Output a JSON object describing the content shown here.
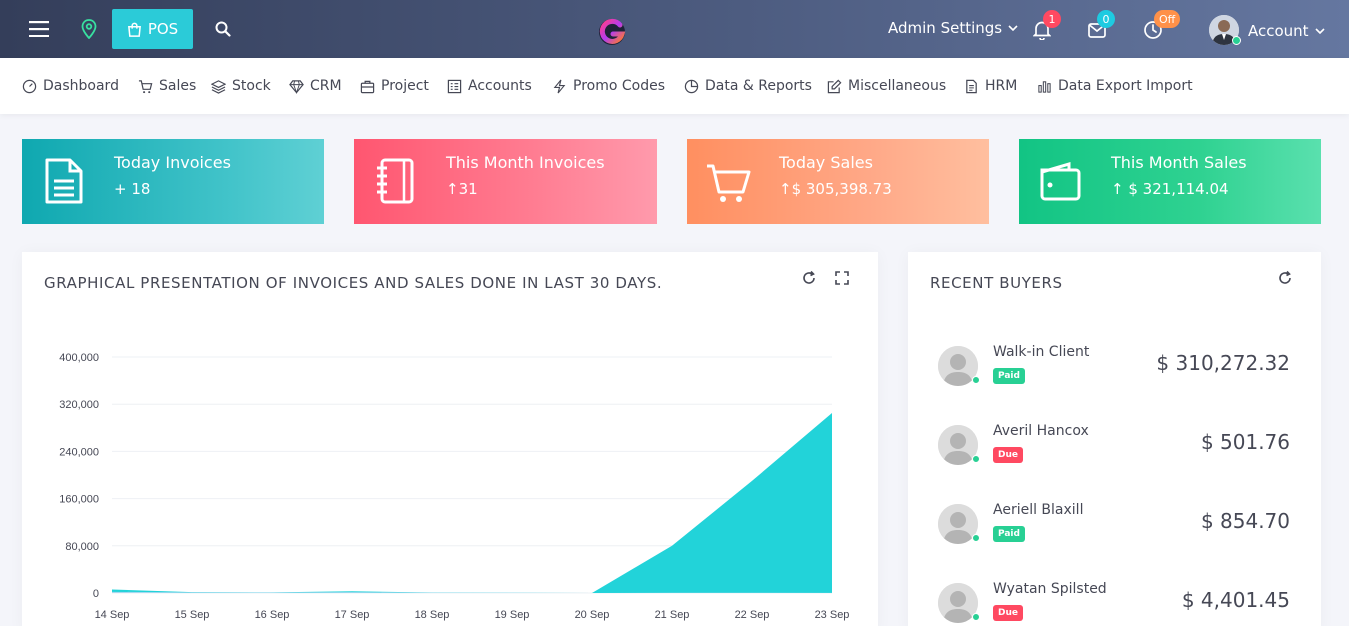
{
  "topbar": {
    "pos_label": "POS",
    "admin_settings": "Admin Settings",
    "notifications_count": "1",
    "messages_count": "0",
    "clock_status": "Off",
    "account_label": "Account"
  },
  "nav": {
    "items": [
      {
        "label": "Dashboard"
      },
      {
        "label": "Sales"
      },
      {
        "label": "Stock"
      },
      {
        "label": "CRM"
      },
      {
        "label": "Project"
      },
      {
        "label": "Accounts"
      },
      {
        "label": "Promo Codes"
      },
      {
        "label": "Data & Reports"
      },
      {
        "label": "Miscellaneous"
      },
      {
        "label": "HRM"
      },
      {
        "label": "Data Export Import"
      }
    ]
  },
  "stats": [
    {
      "title": "Today Invoices",
      "prefix": "+",
      "value": "18"
    },
    {
      "title": "This Month Invoices",
      "prefix": "↑",
      "value": "31"
    },
    {
      "title": "Today Sales",
      "prefix": "↑",
      "value": "$ 305,398.73"
    },
    {
      "title": "This Month Sales",
      "prefix": "↑",
      "value": "$ 321,114.04"
    }
  ],
  "chart_panel": {
    "title": "GRAPHICAL PRESENTATION OF INVOICES AND SALES DONE IN LAST 30 DAYS."
  },
  "chart_data": {
    "type": "area",
    "categories": [
      "14 Sep",
      "15 Sep",
      "16 Sep",
      "17 Sep",
      "18 Sep",
      "19 Sep",
      "20 Sep",
      "21 Sep",
      "22 Sep",
      "23 Sep"
    ],
    "series": [
      {
        "values": [
          6000,
          1500,
          1000,
          3000,
          800,
          500,
          0,
          80000,
          190000,
          305000
        ],
        "color": "#22d3d9"
      },
      {
        "values": [
          2000,
          1000,
          800,
          1500,
          600,
          400,
          0,
          500,
          400,
          300
        ],
        "color": "#c7dbf5"
      }
    ],
    "yticks": [
      0,
      80000,
      160000,
      240000,
      320000,
      400000
    ],
    "ytick_labels": [
      "0",
      "80,000",
      "160,000",
      "240,000",
      "320,000",
      "400,000"
    ],
    "ylim": [
      0,
      400000
    ],
    "grid": true
  },
  "buyers_panel": {
    "title": "RECENT BUYERS",
    "buyers": [
      {
        "name": "Walk-in Client",
        "status": "Paid",
        "amount": "$ 310,272.32"
      },
      {
        "name": "Averil Hancox",
        "status": "Due",
        "amount": "$ 501.76"
      },
      {
        "name": "Aeriell Blaxill",
        "status": "Paid",
        "amount": "$ 854.70"
      },
      {
        "name": "Wyatan Spilsted",
        "status": "Due",
        "amount": "$ 4,401.45"
      }
    ]
  }
}
